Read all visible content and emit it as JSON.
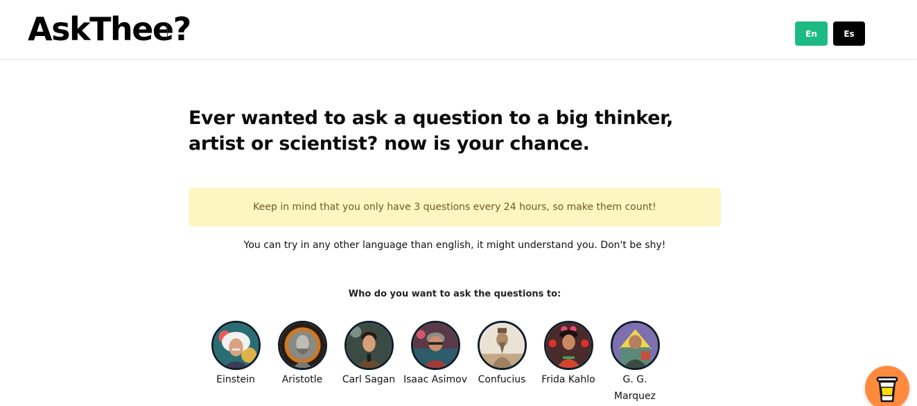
{
  "header": {
    "logo": "AskThee?",
    "languages": [
      {
        "label": "En",
        "active": true,
        "color": "#1dba84"
      },
      {
        "label": "Es",
        "active": false,
        "color": "#000000"
      }
    ]
  },
  "main": {
    "headline": "Ever wanted to ask a question to a big thinker, artist or scientist? now is your chance.",
    "notice": "Keep in mind that you only have 3 questions every 24 hours, so make them count!",
    "subtext": "You can try in any other language than english, it might understand you. Don't be shy!",
    "prompt": "Who do you want to ask the questions to:"
  },
  "people": [
    {
      "name": "Einstein",
      "icon": "einstein-portrait"
    },
    {
      "name": "Aristotle",
      "icon": "aristotle-portrait"
    },
    {
      "name": "Carl Sagan",
      "icon": "carl-sagan-portrait"
    },
    {
      "name": "Isaac Asimov",
      "icon": "isaac-asimov-portrait"
    },
    {
      "name": "Confucius",
      "icon": "confucius-portrait"
    },
    {
      "name": "Frida Kahlo",
      "icon": "frida-kahlo-portrait"
    },
    {
      "name": "G. G. Marquez",
      "icon": "gg-marquez-portrait"
    }
  ],
  "floating": {
    "icon": "coffee-cup-icon",
    "color": "#ff8a3d"
  }
}
